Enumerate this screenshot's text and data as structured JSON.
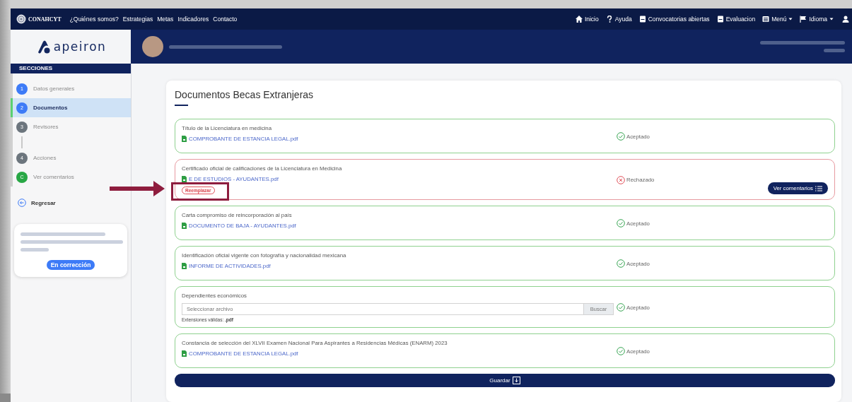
{
  "top_nav": {
    "brand": "CONAHCYT",
    "links": [
      "¿Quiénes somos?",
      "Estrategias",
      "Metas",
      "Indicadores",
      "Contacto"
    ],
    "actions": [
      {
        "label": "Inicio",
        "kind": "home",
        "dropdown": false
      },
      {
        "label": "Ayuda",
        "kind": "help",
        "dropdown": false
      },
      {
        "label": "Convocatorias abiertas",
        "kind": "book",
        "dropdown": false
      },
      {
        "label": "Evaluacion",
        "kind": "book",
        "dropdown": false
      },
      {
        "label": "Menú",
        "kind": "list",
        "dropdown": true
      },
      {
        "label": "Idioma",
        "kind": "flag",
        "dropdown": true
      }
    ]
  },
  "logo": {
    "text": "apeiron"
  },
  "sidebar": {
    "title": "SECCIONES",
    "items": [
      {
        "badge": "1",
        "label": "Datos generales",
        "color": "#3d7bf7",
        "selected": false
      },
      {
        "badge": "2",
        "label": "Documentos",
        "color": "#3d7bf7",
        "selected": true
      },
      {
        "badge": "3",
        "label": "Revisores",
        "color": "#6c757d",
        "selected": false
      },
      {
        "badge": "4",
        "label": "Acciones",
        "color": "#6c757d",
        "selected": false
      },
      {
        "badge": "C",
        "label": "Ver comentarios",
        "color": "#28a745",
        "selected": false
      }
    ],
    "back": "Regresar",
    "status": "En corrección"
  },
  "page": {
    "title": "Documentos Becas Extranjeras",
    "documents": [
      {
        "kind": "file",
        "title": "Título de la Licenciatura en medicina",
        "file": "COMPROBANTE DE ESTANCIA LEGAL.pdf",
        "accepted": true,
        "status_label": "Aceptado"
      },
      {
        "kind": "file",
        "title": "Certificado oficial de calificaciones de la Licenciatura en Medicina",
        "file": "E DE ESTUDIOS - AYUDANTES.pdf",
        "accepted": false,
        "status_label": "Rechazado",
        "replace": "Reemplazar",
        "comments": "Ver comentarios"
      },
      {
        "kind": "file",
        "title": "Carta compromiso de reincorporación al país",
        "file": "DOCUMENTO DE BAJA - AYUDANTES.pdf",
        "accepted": true,
        "status_label": "Aceptado"
      },
      {
        "kind": "file",
        "title": "Identificación oficial vigente con fotografía y nacionalidad mexicana",
        "file": "INFORME DE ACTIVIDADES.pdf",
        "accepted": true,
        "status_label": "Aceptado"
      },
      {
        "kind": "upload",
        "title": "Dependientes económicos",
        "placeholder": "Seleccionar archivo",
        "browse": "Buscar",
        "hint": "Extensiones válidas: **.pdf**",
        "accepted": true,
        "status_label": "Aceptado"
      },
      {
        "kind": "file",
        "title": "Constancia de selección del XLVII Examen Nacional Para Aspirantes a Residencias Médicas (ENARM) 2023",
        "file": "COMPROBANTE DE ESTANCIA LEGAL.pdf",
        "accepted": true,
        "status_label": "Aceptado"
      }
    ],
    "save": "Guardar"
  }
}
